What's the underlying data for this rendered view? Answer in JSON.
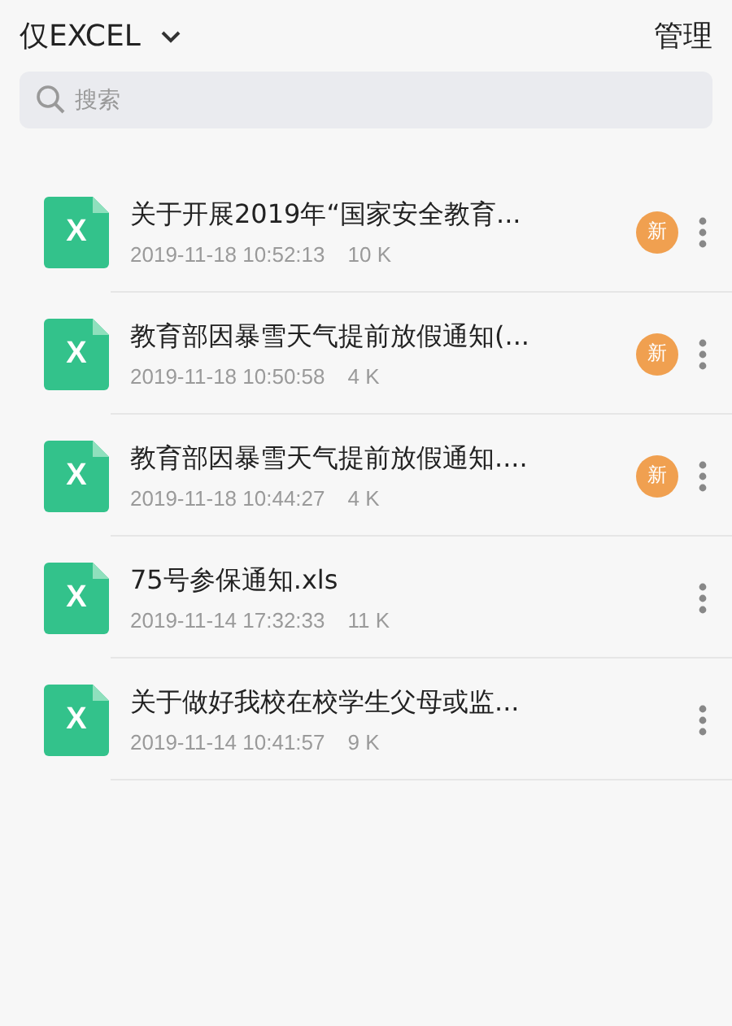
{
  "header": {
    "filter": "仅EXCEL",
    "action": "管理"
  },
  "search": {
    "placeholder": "搜索"
  },
  "files": [
    {
      "icon_text": "X",
      "name": "关于开展2019年“国家安全教育...",
      "date": "2019-11-18 10:52:13",
      "size": "10 K",
      "badge": "新"
    },
    {
      "icon_text": "X",
      "name": "教育部因暴雪天气提前放假通知(...",
      "date": "2019-11-18 10:50:58",
      "size": "4 K",
      "badge": "新"
    },
    {
      "icon_text": "X",
      "name": "教育部因暴雪天气提前放假通知....",
      "date": "2019-11-18 10:44:27",
      "size": "4 K",
      "badge": "新"
    },
    {
      "icon_text": "X",
      "name": "75号参保通知.xls",
      "date": "2019-11-14 17:32:33",
      "size": "11 K"
    },
    {
      "icon_text": "X",
      "name": "关于做好我校在校学生父母或监...",
      "date": "2019-11-14 10:41:57",
      "size": "9 K"
    }
  ]
}
